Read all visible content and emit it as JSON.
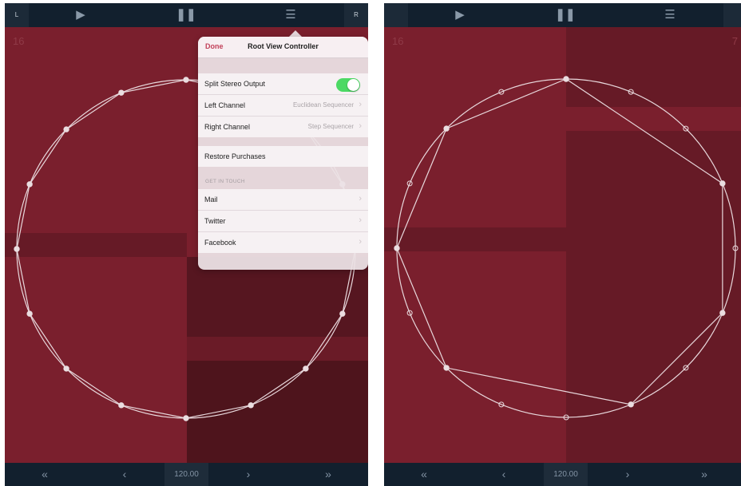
{
  "left_screen": {
    "topbar": {
      "left_tag": "L",
      "play_icon": "play-icon",
      "pause_icon": "pause-icon",
      "menu_icon": "menu-icon",
      "right_tag": "R"
    },
    "corner_left": "16",
    "bottombar": {
      "items": [
        "«",
        "‹",
        "120.00",
        "›",
        "»"
      ]
    },
    "popover": {
      "done_label": "Done",
      "title": "Root View Controller",
      "split_stereo_label": "Split Stereo Output",
      "split_stereo_on": true,
      "left_channel_label": "Left Channel",
      "left_channel_value": "Euclidean Sequencer",
      "right_channel_label": "Right Channel",
      "right_channel_value": "Step Sequencer",
      "restore_label": "Restore Purchases",
      "section_header": "GET IN TOUCH",
      "links": [
        "Mail",
        "Twitter",
        "Facebook"
      ]
    },
    "sequencer": {
      "steps": 16
    }
  },
  "right_screen": {
    "topbar": {
      "play_icon": "play-icon",
      "pause_icon": "pause-icon",
      "menu_icon": "menu-icon"
    },
    "corner_left": "16",
    "corner_right": "7",
    "bottombar": {
      "items": [
        "«",
        "‹",
        "120.00",
        "›",
        "»"
      ]
    },
    "sequencer": {
      "steps": 16,
      "pulses": 7
    }
  },
  "colors": {
    "background": "#7a1f2d",
    "dark_block": "#4e141c",
    "bar": "#12202e",
    "accent": "#c2415a",
    "toggle_on": "#4cd964"
  }
}
